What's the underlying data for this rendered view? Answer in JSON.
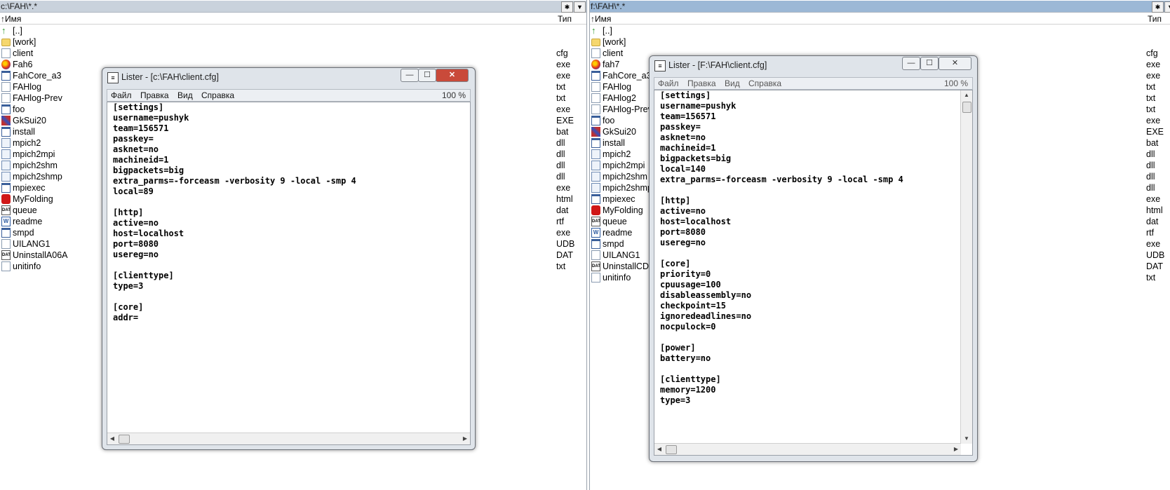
{
  "left_panel": {
    "path": "c:\\FAH\\*.*",
    "col_name": "↑Имя",
    "col_type": "Тип",
    "files": [
      {
        "name": "[..]",
        "type": "",
        "icon": "up-arrow-icon"
      },
      {
        "name": "[work]",
        "type": "",
        "icon": "folder-icon"
      },
      {
        "name": "client",
        "type": "cfg",
        "icon": "document-icon"
      },
      {
        "name": "Fah6",
        "type": "exe",
        "icon": "fah-app-icon"
      },
      {
        "name": "FahCore_a3",
        "type": "exe",
        "icon": "executable-icon"
      },
      {
        "name": "FAHlog",
        "type": "txt",
        "icon": "document-icon"
      },
      {
        "name": "FAHlog-Prev",
        "type": "txt",
        "icon": "document-icon"
      },
      {
        "name": "foo",
        "type": "exe",
        "icon": "executable-icon"
      },
      {
        "name": "GkSui20",
        "type": "EXE",
        "icon": "gksui-app-icon"
      },
      {
        "name": "install",
        "type": "bat",
        "icon": "executable-icon"
      },
      {
        "name": "mpich2",
        "type": "dll",
        "icon": "dll-icon"
      },
      {
        "name": "mpich2mpi",
        "type": "dll",
        "icon": "dll-icon"
      },
      {
        "name": "mpich2shm",
        "type": "dll",
        "icon": "dll-icon"
      },
      {
        "name": "mpich2shmp",
        "type": "dll",
        "icon": "dll-icon"
      },
      {
        "name": "mpiexec",
        "type": "exe",
        "icon": "executable-icon"
      },
      {
        "name": "MyFolding",
        "type": "html",
        "icon": "html-icon"
      },
      {
        "name": "queue",
        "type": "dat",
        "icon": "dat-file-icon"
      },
      {
        "name": "readme",
        "type": "rtf",
        "icon": "rtf-file-icon"
      },
      {
        "name": "smpd",
        "type": "exe",
        "icon": "executable-icon"
      },
      {
        "name": "UILANG1",
        "type": "UDB",
        "icon": "document-icon"
      },
      {
        "name": "UninstallA06A",
        "type": "DAT",
        "icon": "dat-file-icon"
      },
      {
        "name": "unitinfo",
        "type": "txt",
        "icon": "document-icon"
      }
    ]
  },
  "right_panel": {
    "path": "f:\\FAH\\*.*",
    "col_name": "↑Имя",
    "col_type": "Тип",
    "files": [
      {
        "name": "[..]",
        "type": "",
        "icon": "up-arrow-icon"
      },
      {
        "name": "[work]",
        "type": "",
        "icon": "folder-icon"
      },
      {
        "name": "client",
        "type": "cfg",
        "icon": "document-icon"
      },
      {
        "name": "fah7",
        "type": "exe",
        "icon": "fah-app-icon"
      },
      {
        "name": "FahCore_a3",
        "type": "exe",
        "icon": "executable-icon"
      },
      {
        "name": "FAHlog",
        "type": "txt",
        "icon": "document-icon"
      },
      {
        "name": "FAHlog2",
        "type": "txt",
        "icon": "document-icon"
      },
      {
        "name": "FAHlog-Prev",
        "type": "txt",
        "icon": "document-icon"
      },
      {
        "name": "foo",
        "type": "exe",
        "icon": "executable-icon"
      },
      {
        "name": "GkSui20",
        "type": "EXE",
        "icon": "gksui-app-icon"
      },
      {
        "name": "install",
        "type": "bat",
        "icon": "executable-icon"
      },
      {
        "name": "mpich2",
        "type": "dll",
        "icon": "dll-icon"
      },
      {
        "name": "mpich2mpi",
        "type": "dll",
        "icon": "dll-icon"
      },
      {
        "name": "mpich2shm",
        "type": "dll",
        "icon": "dll-icon"
      },
      {
        "name": "mpich2shmp",
        "type": "dll",
        "icon": "dll-icon"
      },
      {
        "name": "mpiexec",
        "type": "exe",
        "icon": "executable-icon"
      },
      {
        "name": "MyFolding",
        "type": "html",
        "icon": "html-icon"
      },
      {
        "name": "queue",
        "type": "dat",
        "icon": "dat-file-icon"
      },
      {
        "name": "readme",
        "type": "rtf",
        "icon": "rtf-file-icon"
      },
      {
        "name": "smpd",
        "type": "exe",
        "icon": "executable-icon"
      },
      {
        "name": "UILANG1",
        "type": "UDB",
        "icon": "document-icon"
      },
      {
        "name": "UninstallCD",
        "type": "DAT",
        "icon": "dat-file-icon"
      },
      {
        "name": "unitinfo",
        "type": "txt",
        "icon": "document-icon"
      }
    ]
  },
  "lister_left": {
    "title": "Lister - [c:\\FAH\\client.cfg]",
    "menu": [
      "Файл",
      "Правка",
      "Вид",
      "Справка"
    ],
    "zoom": "100 %",
    "text": "[settings]\nusername=pushyk\nteam=156571\npasskey=\nasknet=no\nmachineid=1\nbigpackets=big\nextra_parms=-forceasm -verbosity 9 -local -smp 4\nlocal=89\n\n[http]\nactive=no\nhost=localhost\nport=8080\nusereg=no\n\n[clienttype]\ntype=3\n\n[core]\naddr="
  },
  "lister_right": {
    "title": "Lister - [F:\\FAH\\client.cfg]",
    "menu": [
      "Файл",
      "Правка",
      "Вид",
      "Справка"
    ],
    "zoom": "100 %",
    "text": "[settings]\nusername=pushyk\nteam=156571\npasskey=\nasknet=no\nmachineid=1\nbigpackets=big\nlocal=140\nextra_parms=-forceasm -verbosity 9 -local -smp 4\n\n[http]\nactive=no\nhost=localhost\nport=8080\nusereg=no\n\n[core]\npriority=0\ncpuusage=100\ndisableassembly=no\ncheckpoint=15\nignoredeadlines=no\nnocpulock=0\n\n[power]\nbattery=no\n\n[clienttype]\nmemory=1200\ntype=3"
  },
  "window_controls": {
    "minimize": "—",
    "maximize": "☐",
    "close": "✕"
  },
  "path_buttons": {
    "star": "✱",
    "dropdown": "▼"
  }
}
